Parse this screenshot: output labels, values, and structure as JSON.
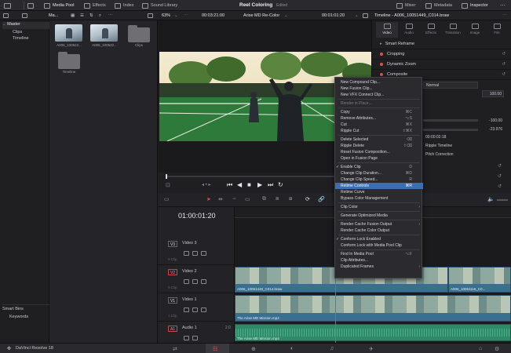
{
  "topbar": {
    "media_pool": "Media Pool",
    "effects": "Effects",
    "index": "Index",
    "sound_library": "Sound Library",
    "project_title": "Reel Coloring",
    "edited": "Edited",
    "mixer": "Mixer",
    "metadata": "Metadata",
    "inspector": "Inspector"
  },
  "subbar": {
    "pool_menu": "Ma...",
    "zoom": "63%",
    "source_tc": "00:03:21:00",
    "timeline_name": "Arise MD Re-Color",
    "record_tc": "00:01:01:20",
    "inspector_title": "Timeline - A006_10051449_C014.braw"
  },
  "sidebar": {
    "root": "Master",
    "items": [
      "Clips",
      "Timeline"
    ],
    "smart_bins": "Smart Bins",
    "keywords": "Keywords"
  },
  "pool": {
    "items": [
      {
        "label": "A006_100522..."
      },
      {
        "label": "A006_100522..."
      },
      {
        "label": "Clips"
      },
      {
        "label": "Timeline"
      }
    ]
  },
  "inspector": {
    "tabs": [
      "Video",
      "Audio",
      "Effects",
      "Transition",
      "Image",
      "File"
    ],
    "smart_reframe": "Smart Reframe",
    "sections": [
      "Cropping",
      "Dynamic Zoom",
      "Composite"
    ],
    "composite_mode": "Normal",
    "opacity": "100.00",
    "value_a": "-100.00",
    "value_b": "-23.976",
    "timecode": "00:00:02:18",
    "ripple_timeline": "Ripple Timeline",
    "pitch_correction": "Pitch Correction"
  },
  "timeline": {
    "timecode": "01:00:01:20",
    "tracks": [
      {
        "badge": "V3",
        "name": "Video 3",
        "count": "0 Clip"
      },
      {
        "badge": "V2",
        "name": "Video 2",
        "count": "0 Clip"
      },
      {
        "badge": "V1",
        "name": "Video 1",
        "count": "1 Clip"
      },
      {
        "badge": "A1",
        "name": "Audio 1",
        "count": "2.0"
      }
    ],
    "clip_v2_a": "A006_10051449_C014.braw",
    "clip_v2_b": "A006_10051115_C0...",
    "clip_v1": "The Arise MD Mission.mp4",
    "clip_a1": "The Arise MD Mission.mp4"
  },
  "context_menu": {
    "items": [
      {
        "label": "New Compound Clip...",
        "shortcut": ""
      },
      {
        "label": "New Fusion Clip...",
        "shortcut": ""
      },
      {
        "label": "New VFX Connect Clip...",
        "shortcut": ""
      },
      {
        "label": "Render in Place...",
        "shortcut": ""
      },
      {
        "label": "Copy",
        "shortcut": "⌘C"
      },
      {
        "label": "Remove Attributes...",
        "shortcut": "⌥S"
      },
      {
        "label": "Cut",
        "shortcut": "⌘X"
      },
      {
        "label": "Ripple Cut",
        "shortcut": "⇧⌘X"
      },
      {
        "label": "Delete Selected",
        "shortcut": "⌫"
      },
      {
        "label": "Ripple Delete",
        "shortcut": "⇧⌫"
      },
      {
        "label": "Reset Fusion Composition...",
        "shortcut": ""
      },
      {
        "label": "Open in Fusion Page",
        "shortcut": ""
      },
      {
        "label": "Enable Clip",
        "shortcut": "D"
      },
      {
        "label": "Change Clip Duration...",
        "shortcut": "⌘D"
      },
      {
        "label": "Change Clip Speed...",
        "shortcut": "R"
      },
      {
        "label": "Retime Controls",
        "shortcut": "⌘R"
      },
      {
        "label": "Retime Curve",
        "shortcut": ""
      },
      {
        "label": "Bypass Color Management",
        "shortcut": ""
      },
      {
        "label": "Clip Color",
        "shortcut": ""
      },
      {
        "label": "Generate Optimized Media",
        "shortcut": ""
      },
      {
        "label": "Render Cache Fusion Output",
        "shortcut": ""
      },
      {
        "label": "Render Cache Color Output",
        "shortcut": ""
      },
      {
        "label": "Conform Lock Enabled",
        "shortcut": ""
      },
      {
        "label": "Conform Lock with Media Pool Clip",
        "shortcut": ""
      },
      {
        "label": "Find In Media Pool",
        "shortcut": "⌥F"
      },
      {
        "label": "Clip Attributes...",
        "shortcut": ""
      },
      {
        "label": "Duplicated Frames",
        "shortcut": ""
      }
    ]
  },
  "bottombar": {
    "app_name": "DaVinci Resolve 18"
  }
}
